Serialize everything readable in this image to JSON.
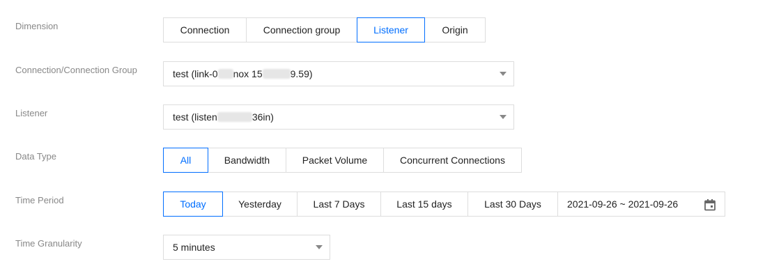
{
  "dimension": {
    "label": "Dimension",
    "options": [
      "Connection",
      "Connection group",
      "Listener",
      "Origin"
    ],
    "selected": "Listener"
  },
  "connection_group": {
    "label": "Connection/Connection Group",
    "value_start": "test (link-0",
    "value_mid": "nox 15",
    "value_end": "9.59)"
  },
  "listener": {
    "label": "Listener",
    "value_start": "test (listen",
    "value_end": "36in)"
  },
  "data_type": {
    "label": "Data Type",
    "options": [
      "All",
      "Bandwidth",
      "Packet Volume",
      "Concurrent Connections"
    ],
    "selected": "All"
  },
  "time_period": {
    "label": "Time Period",
    "options": [
      "Today",
      "Yesterday",
      "Last 7 Days",
      "Last 15 days",
      "Last 30 Days"
    ],
    "selected": "Today",
    "date_range": "2021-09-26 ~ 2021-09-26",
    "calendar_icon": "calendar-icon"
  },
  "time_granularity": {
    "label": "Time Granularity",
    "value": "5 minutes"
  },
  "colors": {
    "accent": "#006eff",
    "border": "#dddddd",
    "label": "#888888"
  }
}
